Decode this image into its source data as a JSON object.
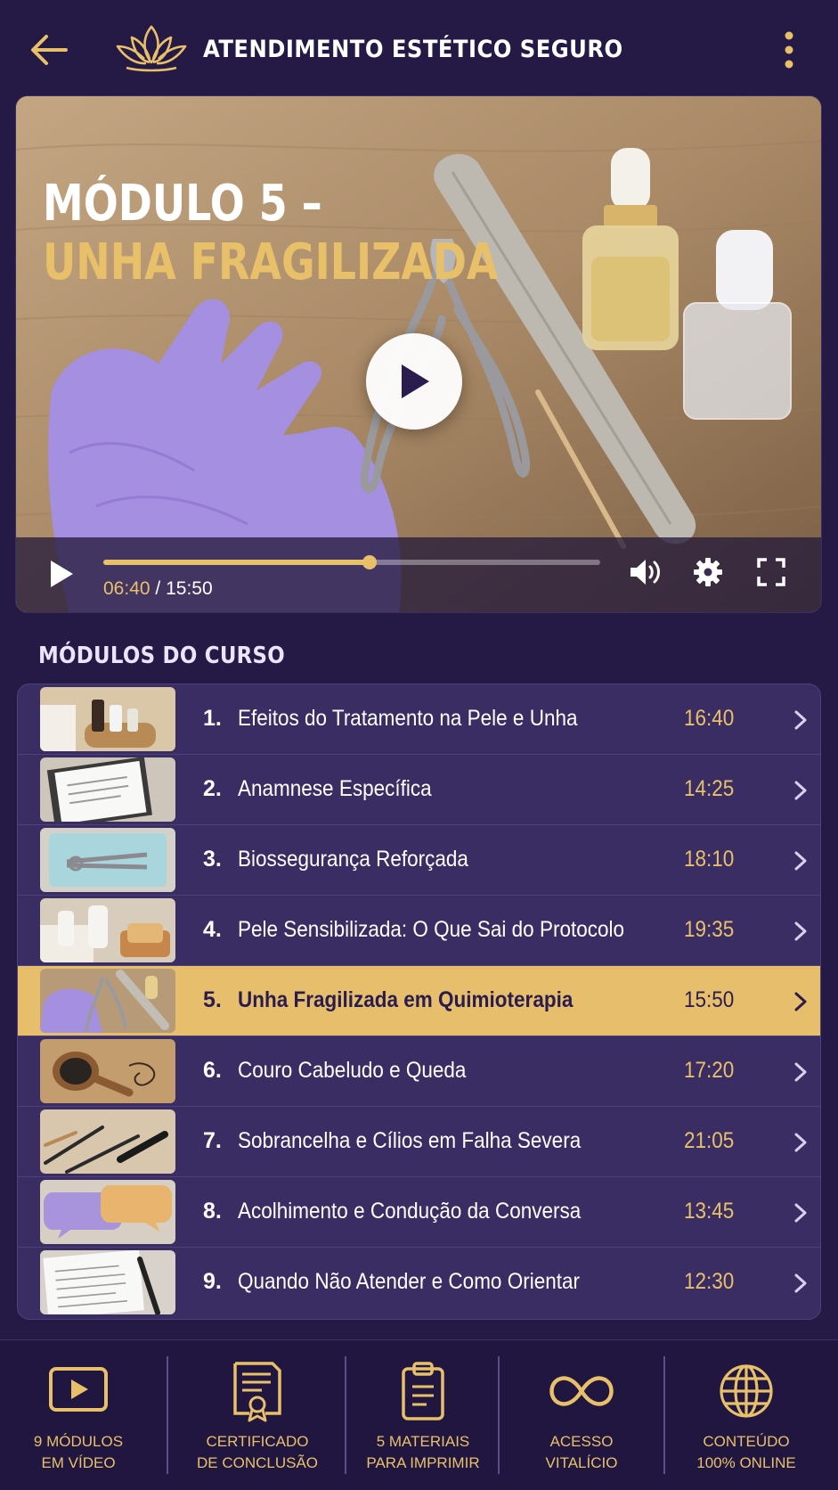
{
  "header": {
    "title": "ATENDIMENTO ESTÉTICO SEGURO",
    "back_icon": "arrow-left-icon",
    "logo_icon": "lotus-icon",
    "menu_icon": "more-vertical-icon"
  },
  "video": {
    "title_line1": "MÓDULO 5 –",
    "title_line2": "UNHA FRAGILIZADA",
    "current_time": "06:40",
    "separator": "/",
    "total_time": "15:50",
    "progress": 0.536
  },
  "modules_section": {
    "title": "MÓDULOS DO CURSO",
    "items": [
      {
        "num": "1.",
        "title": "Efeitos do Tratamento na Pele e Unha",
        "duration": "16:40",
        "active": false,
        "thumb": "products"
      },
      {
        "num": "2.",
        "title": "Anamnese Específica",
        "duration": "14:25",
        "active": false,
        "thumb": "clipboard"
      },
      {
        "num": "3.",
        "title": "Biossegurança Reforçada",
        "duration": "18:10",
        "active": false,
        "thumb": "sterile"
      },
      {
        "num": "4.",
        "title": "Pele Sensibilizada: O Que Sai do Protocolo",
        "duration": "19:35",
        "active": false,
        "thumb": "soap"
      },
      {
        "num": "5.",
        "title": "Unha Fragilizada em Quimioterapia",
        "duration": "15:50",
        "active": true,
        "thumb": "glove"
      },
      {
        "num": "6.",
        "title": "Couro Cabeludo e Queda",
        "duration": "17:20",
        "active": false,
        "thumb": "brush"
      },
      {
        "num": "7.",
        "title": "Sobrancelha e Cílios em Falha Severa",
        "duration": "21:05",
        "active": false,
        "thumb": "brow"
      },
      {
        "num": "8.",
        "title": "Acolhimento e Condução da Conversa",
        "duration": "13:45",
        "active": false,
        "thumb": "chat"
      },
      {
        "num": "9.",
        "title": "Quando Não Atender e Como Orientar",
        "duration": "12:30",
        "active": false,
        "thumb": "form"
      }
    ]
  },
  "features": [
    {
      "label": "9 MÓDULOS\nEM VÍDEO",
      "icon": "video-play-icon"
    },
    {
      "label": "CERTIFICADO\nDE CONCLUSÃO",
      "icon": "certificate-icon"
    },
    {
      "label": "5 MATERIAIS\nPARA IMPRIMIR",
      "icon": "clipboard-icon"
    },
    {
      "label": "ACESSO\nVITALÍCIO",
      "icon": "infinity-icon"
    },
    {
      "label": "CONTEÚDO\n100% ONLINE",
      "icon": "globe-icon"
    }
  ],
  "colors": {
    "background": "#241a45",
    "accent_gold": "#e8c06a",
    "row": "#3a2d64",
    "active_row": "#e7bf6c"
  }
}
